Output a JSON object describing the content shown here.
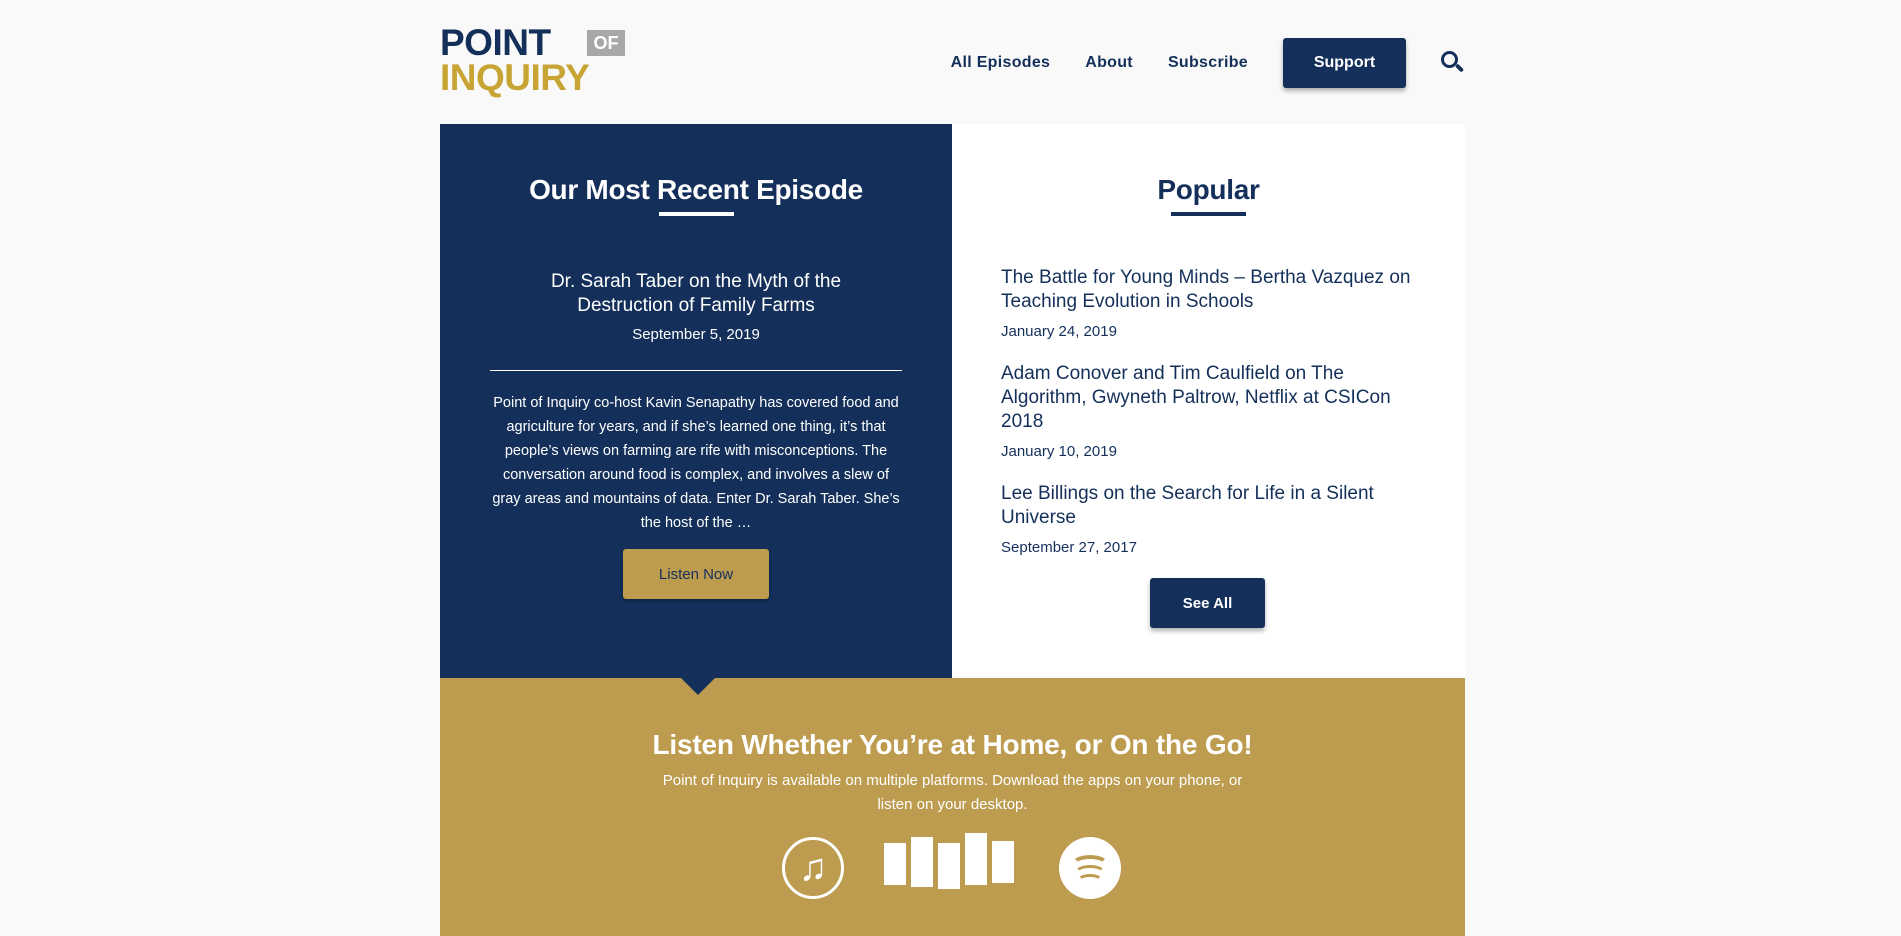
{
  "header": {
    "logo": {
      "line1": "POINT",
      "badge": "OF",
      "line2": "INQUIRY"
    },
    "nav": [
      "All Episodes",
      "About",
      "Subscribe"
    ],
    "support_label": "Support",
    "search_icon": "search-icon"
  },
  "recent": {
    "heading": "Our Most Recent Episode",
    "episode_title": "Dr. Sarah Taber on the Myth of the Destruction of Family Farms",
    "episode_date": "September 5, 2019",
    "description": "Point of Inquiry co-host Kavin Senapathy has covered food and agriculture for years, and if she’s learned one thing, it’s that people’s views on farming are rife with misconceptions. The conversation around food is complex, and involves a slew of gray areas and mountains of data. Enter Dr. Sarah Taber. She’s the host of the …",
    "listen_label": "Listen Now"
  },
  "popular": {
    "heading": "Popular",
    "items": [
      {
        "title": "The Battle for Young Minds – Bertha Vazquez on Teaching Evolution in Schools",
        "date": "January 24, 2019"
      },
      {
        "title": "Adam Conover and Tim Caulfield on The Algorithm, Gwyneth Paltrow, Netflix at CSICon 2018",
        "date": "January 10, 2019"
      },
      {
        "title": "Lee Billings on the Search for Life in a Silent Universe",
        "date": "September 27, 2017"
      }
    ],
    "see_all_label": "See All"
  },
  "platforms": {
    "heading": "Listen Whether You’re at Home, or On the Go!",
    "description": "Point of Inquiry is available on multiple platforms. Download the apps on your phone, or listen on your desktop.",
    "icons": [
      "itunes-icon",
      "stitcher-icon",
      "spotify-icon"
    ]
  },
  "colors": {
    "navy": "#14305a",
    "gold": "#bd9c4f",
    "logo_gold": "#c8a434",
    "background": "#f9f9f9"
  }
}
